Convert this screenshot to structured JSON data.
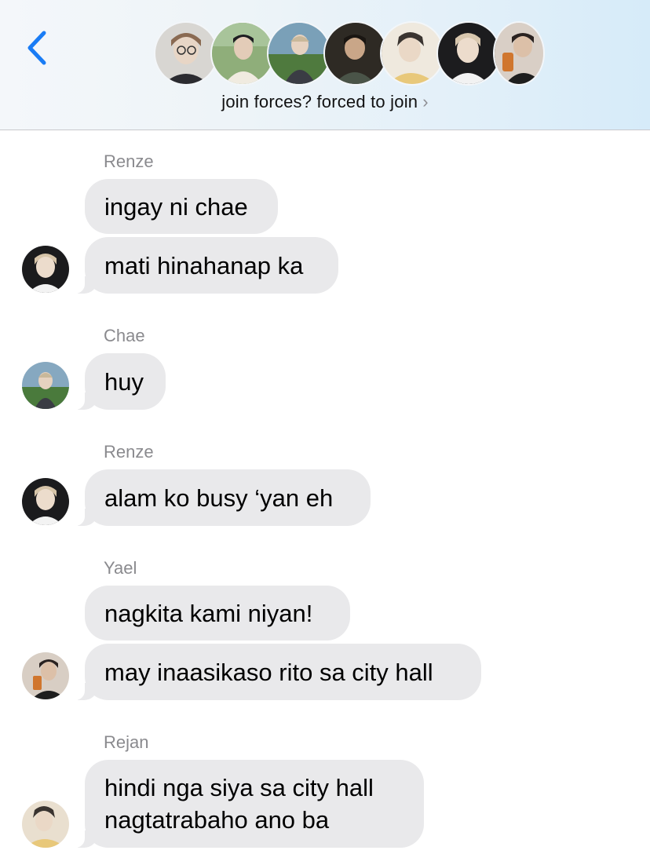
{
  "header": {
    "group_name": "join forces? forced to join",
    "chevron": "›",
    "back_icon": "chevron-left-icon",
    "accent_color": "#1a7cf5",
    "member_avatars": [
      "avatar-1",
      "avatar-2",
      "avatar-3",
      "avatar-4",
      "avatar-5",
      "avatar-6",
      "avatar-7"
    ]
  },
  "messages": [
    {
      "sender": "Renze",
      "bubbles": [
        "ingay ni chae",
        "mati hinahanap ka"
      ]
    },
    {
      "sender": "Chae",
      "bubbles": [
        "huy"
      ]
    },
    {
      "sender": "Renze",
      "bubbles": [
        "alam ko busy ‘yan eh"
      ]
    },
    {
      "sender": "Yael",
      "bubbles": [
        "nagkita kami niyan!",
        "may inaasikaso rito sa city hall"
      ]
    },
    {
      "sender": "Rejan",
      "bubbles": [
        [
          "hindi nga siya sa city hall",
          "nagtatrabaho ano ba"
        ]
      ]
    }
  ],
  "colors": {
    "bubble_gray": "#e9e9eb",
    "sender_gray": "#8a8a8e"
  }
}
